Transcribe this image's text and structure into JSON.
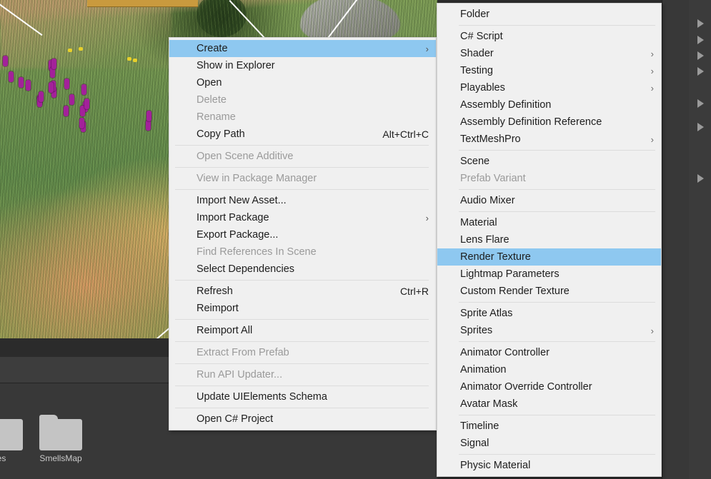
{
  "app": {
    "name": "Unity Editor",
    "highlight_color": "#8ec8f0",
    "menu_bg": "#f0f0f0"
  },
  "scene_view": {
    "name": "Scene View",
    "description": "procedural grass terrain with purple flowers"
  },
  "project_browser": {
    "assets": [
      {
        "label": "es",
        "icon": "folder-icon"
      },
      {
        "label": "SmellsMap",
        "icon": "folder-icon"
      }
    ]
  },
  "context_menu": {
    "name": "asset-context-menu",
    "items": [
      {
        "label": "Create",
        "shortcut": "",
        "submenu": true,
        "disabled": false,
        "highlighted": true
      },
      {
        "label": "Show in Explorer",
        "shortcut": "",
        "submenu": false,
        "disabled": false,
        "highlighted": false
      },
      {
        "label": "Open",
        "shortcut": "",
        "submenu": false,
        "disabled": false,
        "highlighted": false
      },
      {
        "label": "Delete",
        "shortcut": "",
        "submenu": false,
        "disabled": true,
        "highlighted": false
      },
      {
        "label": "Rename",
        "shortcut": "",
        "submenu": false,
        "disabled": true,
        "highlighted": false
      },
      {
        "label": "Copy Path",
        "shortcut": "Alt+Ctrl+C",
        "submenu": false,
        "disabled": false,
        "highlighted": false
      },
      {
        "separator": true
      },
      {
        "label": "Open Scene Additive",
        "shortcut": "",
        "submenu": false,
        "disabled": true,
        "highlighted": false
      },
      {
        "separator": true
      },
      {
        "label": "View in Package Manager",
        "shortcut": "",
        "submenu": false,
        "disabled": true,
        "highlighted": false
      },
      {
        "separator": true
      },
      {
        "label": "Import New Asset...",
        "shortcut": "",
        "submenu": false,
        "disabled": false,
        "highlighted": false
      },
      {
        "label": "Import Package",
        "shortcut": "",
        "submenu": true,
        "disabled": false,
        "highlighted": false
      },
      {
        "label": "Export Package...",
        "shortcut": "",
        "submenu": false,
        "disabled": false,
        "highlighted": false
      },
      {
        "label": "Find References In Scene",
        "shortcut": "",
        "submenu": false,
        "disabled": true,
        "highlighted": false
      },
      {
        "label": "Select Dependencies",
        "shortcut": "",
        "submenu": false,
        "disabled": false,
        "highlighted": false
      },
      {
        "separator": true
      },
      {
        "label": "Refresh",
        "shortcut": "Ctrl+R",
        "submenu": false,
        "disabled": false,
        "highlighted": false
      },
      {
        "label": "Reimport",
        "shortcut": "",
        "submenu": false,
        "disabled": false,
        "highlighted": false
      },
      {
        "separator": true
      },
      {
        "label": "Reimport All",
        "shortcut": "",
        "submenu": false,
        "disabled": false,
        "highlighted": false
      },
      {
        "separator": true
      },
      {
        "label": "Extract From Prefab",
        "shortcut": "",
        "submenu": false,
        "disabled": true,
        "highlighted": false
      },
      {
        "separator": true
      },
      {
        "label": "Run API Updater...",
        "shortcut": "",
        "submenu": false,
        "disabled": true,
        "highlighted": false
      },
      {
        "separator": true
      },
      {
        "label": "Update UIElements Schema",
        "shortcut": "",
        "submenu": false,
        "disabled": false,
        "highlighted": false
      },
      {
        "separator": true
      },
      {
        "label": "Open C# Project",
        "shortcut": "",
        "submenu": false,
        "disabled": false,
        "highlighted": false
      }
    ]
  },
  "create_submenu": {
    "name": "create-submenu",
    "items": [
      {
        "label": "Folder",
        "submenu": false,
        "disabled": false,
        "highlighted": false
      },
      {
        "separator": true
      },
      {
        "label": "C# Script",
        "submenu": false,
        "disabled": false,
        "highlighted": false
      },
      {
        "label": "Shader",
        "submenu": true,
        "disabled": false,
        "highlighted": false
      },
      {
        "label": "Testing",
        "submenu": true,
        "disabled": false,
        "highlighted": false
      },
      {
        "label": "Playables",
        "submenu": true,
        "disabled": false,
        "highlighted": false
      },
      {
        "label": "Assembly Definition",
        "submenu": false,
        "disabled": false,
        "highlighted": false
      },
      {
        "label": "Assembly Definition Reference",
        "submenu": false,
        "disabled": false,
        "highlighted": false
      },
      {
        "label": "TextMeshPro",
        "submenu": true,
        "disabled": false,
        "highlighted": false
      },
      {
        "separator": true
      },
      {
        "label": "Scene",
        "submenu": false,
        "disabled": false,
        "highlighted": false
      },
      {
        "label": "Prefab Variant",
        "submenu": false,
        "disabled": true,
        "highlighted": false
      },
      {
        "separator": true
      },
      {
        "label": "Audio Mixer",
        "submenu": false,
        "disabled": false,
        "highlighted": false
      },
      {
        "separator": true
      },
      {
        "label": "Material",
        "submenu": false,
        "disabled": false,
        "highlighted": false
      },
      {
        "label": "Lens Flare",
        "submenu": false,
        "disabled": false,
        "highlighted": false
      },
      {
        "label": "Render Texture",
        "submenu": false,
        "disabled": false,
        "highlighted": true
      },
      {
        "label": "Lightmap Parameters",
        "submenu": false,
        "disabled": false,
        "highlighted": false
      },
      {
        "label": "Custom Render Texture",
        "submenu": false,
        "disabled": false,
        "highlighted": false
      },
      {
        "separator": true
      },
      {
        "label": "Sprite Atlas",
        "submenu": false,
        "disabled": false,
        "highlighted": false
      },
      {
        "label": "Sprites",
        "submenu": true,
        "disabled": false,
        "highlighted": false
      },
      {
        "separator": true
      },
      {
        "label": "Animator Controller",
        "submenu": false,
        "disabled": false,
        "highlighted": false
      },
      {
        "label": "Animation",
        "submenu": false,
        "disabled": false,
        "highlighted": false
      },
      {
        "label": "Animator Override Controller",
        "submenu": false,
        "disabled": false,
        "highlighted": false
      },
      {
        "label": "Avatar Mask",
        "submenu": false,
        "disabled": false,
        "highlighted": false
      },
      {
        "separator": true
      },
      {
        "label": "Timeline",
        "submenu": false,
        "disabled": false,
        "highlighted": false
      },
      {
        "label": "Signal",
        "submenu": false,
        "disabled": false,
        "highlighted": false
      },
      {
        "separator": true
      },
      {
        "label": "Physic Material",
        "submenu": false,
        "disabled": false,
        "highlighted": false
      }
    ]
  },
  "icons": {
    "submenu_arrow": "›",
    "expand_triangle": "expand-triangle-icon"
  }
}
